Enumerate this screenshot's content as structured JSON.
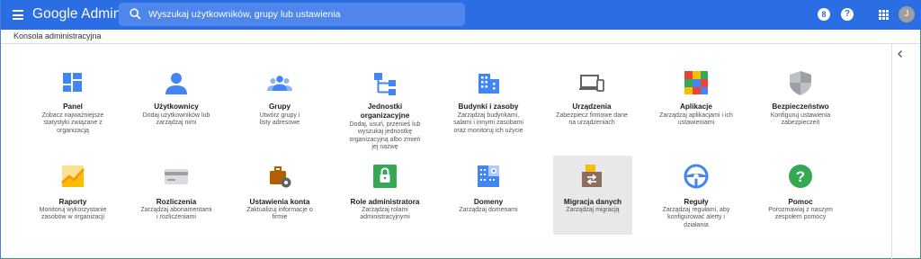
{
  "header": {
    "app_title": "Google Admin",
    "search_placeholder": "Wyszukaj użytkowników, grupy lub ustawienia",
    "notifications_count": "8",
    "help_label": "?",
    "avatar_initial": "J"
  },
  "breadcrumb": {
    "label": "Konsola administracyjna"
  },
  "tiles_row1": [
    {
      "title": "Panel",
      "desc": "Zobacz najważniejsze statystyki związane z organizacją",
      "icon": "dashboard-icon"
    },
    {
      "title": "Użytkownicy",
      "desc": "Dodaj użytkowników lub zarządzaj nimi",
      "icon": "user-icon"
    },
    {
      "title": "Grupy",
      "desc": "Utwórz grupy i listy adresowe",
      "icon": "groups-icon"
    },
    {
      "title": "Jednostki organizacyjne",
      "desc": "Dodaj, usuń, przenieś lub wyszukaj jednostkę organizacyjną albo zmień jej nazwę",
      "icon": "org-units-icon"
    },
    {
      "title": "Budynki i zasoby",
      "desc": "Zarządzaj budynkami, salami i innymi zasobami oraz monitoruj ich użycie",
      "icon": "building-icon"
    },
    {
      "title": "Urządzenia",
      "desc": "Zabezpiecz firmowe dane na urządzeniach",
      "icon": "devices-icon"
    },
    {
      "title": "Aplikacje",
      "desc": "Zarządzaj aplikacjami i ich ustawieniami",
      "icon": "apps-icon"
    },
    {
      "title": "Bezpieczeństwo",
      "desc": "Konfiguruj ustawienia zabezpieczeń",
      "icon": "shield-icon"
    }
  ],
  "tiles_row2": [
    {
      "title": "Raporty",
      "desc": "Monitoruj wykorzystanie zasobów w organizacji",
      "icon": "reports-icon"
    },
    {
      "title": "Rozliczenia",
      "desc": "Zarządzaj abonamentami i rozliczeniami",
      "icon": "billing-icon"
    },
    {
      "title": "Ustawienia konta",
      "desc": "Zaktualizuj informacje o firmie",
      "icon": "account-settings-icon"
    },
    {
      "title": "Role administratora",
      "desc": "Zarządzaj rolami administracyjnymi",
      "icon": "admin-roles-icon"
    },
    {
      "title": "Domeny",
      "desc": "Zarządzaj domenami",
      "icon": "domains-icon"
    },
    {
      "title": "Migracja danych",
      "desc": "Zarządzaj migracją",
      "icon": "data-migration-icon"
    },
    {
      "title": "Reguły",
      "desc": "Zarządzaj regułami, aby konfigurować alerty i działania",
      "icon": "rules-icon"
    },
    {
      "title": "Pomoc",
      "desc": "Porozmawiaj z naszym zespołem pomocy",
      "icon": "help-icon"
    }
  ],
  "colors": {
    "header": "#2b6de3",
    "blue": "#4285f4",
    "green": "#34a853",
    "red": "#ea4335",
    "yellow": "#fbbc04",
    "selected_tile": "#e8e8e8"
  }
}
